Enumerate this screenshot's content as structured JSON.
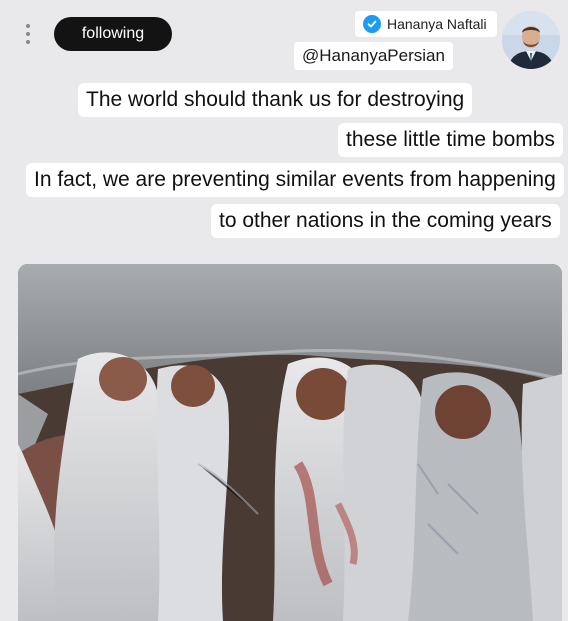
{
  "header": {
    "follow_label": "following",
    "display_name": "Hananya Naftali",
    "handle": "@HananyaPersian"
  },
  "icons": {
    "menu": "vertical-dots-icon",
    "verified": "verified-badge-icon",
    "avatar": "profile-avatar"
  },
  "post": {
    "lines": [
      "The world should thank us for destroying",
      "these little time bombs",
      "In fact, we are preventing similar events from happening",
      "to other nations in the coming years"
    ]
  },
  "colors": {
    "follow_button_bg": "#131313",
    "verified_blue": "#1d9bf0",
    "page_bg": "#e9e9eb"
  }
}
